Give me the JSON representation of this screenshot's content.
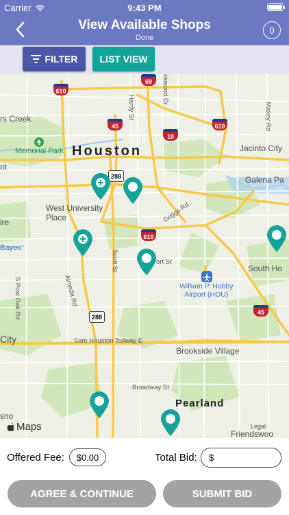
{
  "status_bar": {
    "carrier": "Carrier",
    "time": "9:43 PM"
  },
  "nav": {
    "title": "View Available Shops",
    "subtitle": "Done",
    "cart_count": "0",
    "back_icon": "chevron-left-icon"
  },
  "actions": {
    "filter_label": "FILTER",
    "list_view_label": "LIST VIEW"
  },
  "map": {
    "labels": {
      "houston": "Houston",
      "west_university": "West University\nPlace",
      "memorial_park": "Memorial Park",
      "jacinto_city": "Jacinto City",
      "galena_park": "Galena Pa",
      "south_houston": "South Ho",
      "brookside": "Brookside Village",
      "pearland": "Pearland",
      "friendswood": "Friendswoo",
      "rs_creek": "rs Creek",
      "nt": "nt",
      "ire": "ire",
      "city": "City",
      "sno": "sno",
      "bayou": "Bayou",
      "airport": "William P. Hobby\nAirport (HOU)",
      "hardy_st": "Hardy St",
      "lockwood_dr": "ckwood Dr",
      "maxey_rd": "Maxey Rd",
      "griggs_rd": "Griggs Rd",
      "scott_st": "Scott St",
      "almeda_rd": "Almeda Rd",
      "post_oak_rd": "S Post Oak Rd",
      "sam_houston": "Sam Houston Tollway E",
      "broadway_st": "Broadway St",
      "ort_st": "ort St"
    },
    "shields": [
      "610",
      "69",
      "45",
      "10",
      "610",
      "288",
      "610",
      "288",
      "45"
    ],
    "maps_brand": "Maps",
    "legal": "Legal",
    "marker_icon": "map-pin-icon",
    "marker_color": "#14a39a"
  },
  "bid": {
    "offered_fee_label": "Offered Fee:",
    "offered_fee_value": "$0.00",
    "total_bid_label": "Total Bid:",
    "total_bid_placeholder": "$",
    "agree_label": "AGREE & CONTINUE",
    "submit_label": "SUBMIT BID"
  },
  "colors": {
    "nav": "#6b78c2",
    "filter": "#4a56a6",
    "list_view": "#14a39a",
    "disabled_button": "#a3a3a3"
  }
}
